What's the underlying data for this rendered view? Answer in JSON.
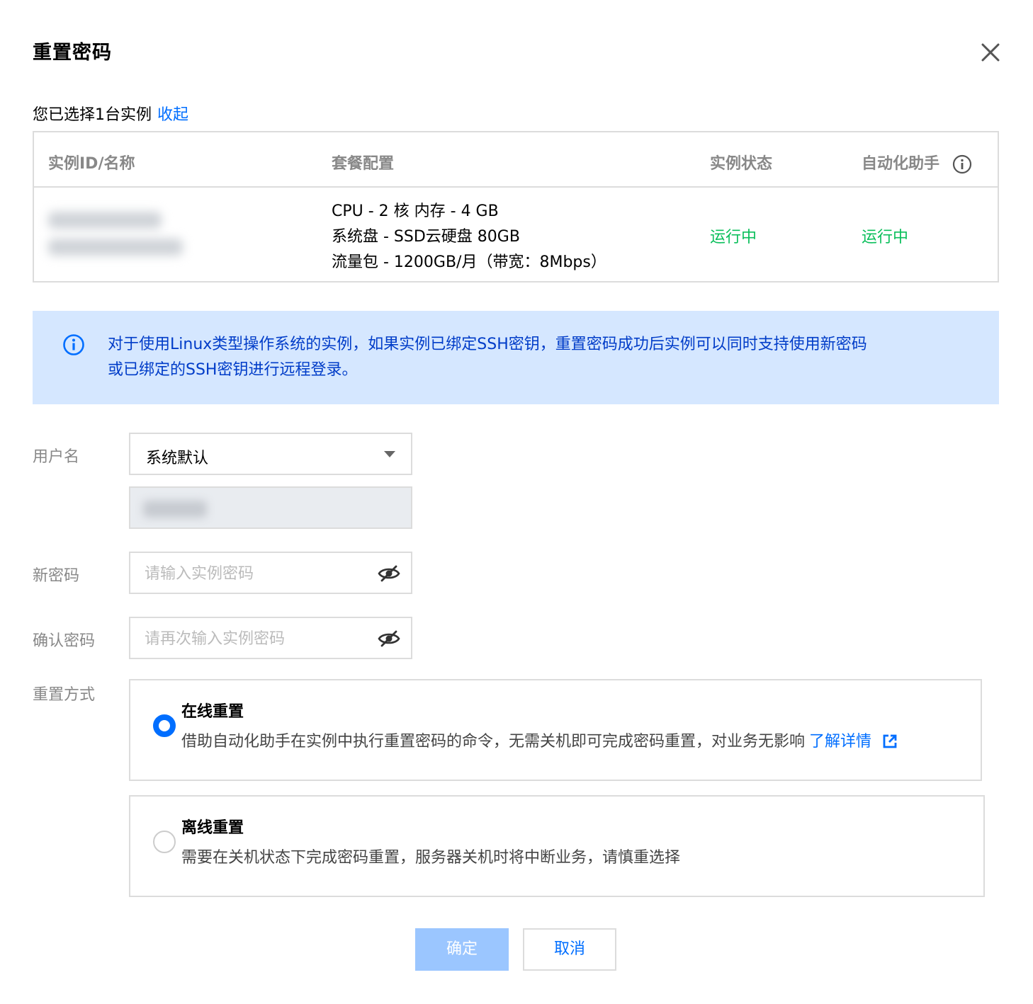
{
  "dialog": {
    "title": "重置密码"
  },
  "selection": {
    "text": "您已选择1台实例",
    "toggle_link": "收起"
  },
  "instance_table": {
    "headers": {
      "id_name": "实例ID/名称",
      "package": "套餐配置",
      "status": "实例状态",
      "agent": "自动化助手"
    },
    "rows": [
      {
        "spec_line1": "CPU - 2 核 内存 - 4 GB",
        "spec_line2": "系统盘 - SSD云硬盘 80GB",
        "spec_line3": "流量包 - 1200GB/月（带宽：8Mbps）",
        "status": "运行中",
        "agent_status": "运行中"
      }
    ]
  },
  "notice": {
    "line1": "对于使用Linux类型操作系统的实例，如果实例已绑定SSH密钥，重置密码成功后实例可以同时支持使用新密码",
    "line2": "或已绑定的SSH密钥进行远程登录。"
  },
  "form": {
    "username_label": "用户名",
    "username_value": "系统默认",
    "new_password_label": "新密码",
    "new_password_placeholder": "请输入实例密码",
    "confirm_password_label": "确认密码",
    "confirm_password_placeholder": "请再次输入实例密码",
    "reset_method_label": "重置方式"
  },
  "reset_options": {
    "online": {
      "title": "在线重置",
      "desc": "借助自动化助手在实例中执行重置密码的命令，无需关机即可完成密码重置，对业务无影响",
      "link": "了解详情",
      "selected": true
    },
    "offline": {
      "title": "离线重置",
      "desc": "需要在关机状态下完成密码重置，服务器关机时将中断业务，请慎重选择",
      "selected": false
    }
  },
  "buttons": {
    "ok": "确定",
    "cancel": "取消"
  },
  "colors": {
    "accent": "#006eff",
    "running": "#0abf5b",
    "notice_bg": "#d5e7ff",
    "notice_text": "#003cc8",
    "ok_disabled": "#9bc6ff"
  }
}
